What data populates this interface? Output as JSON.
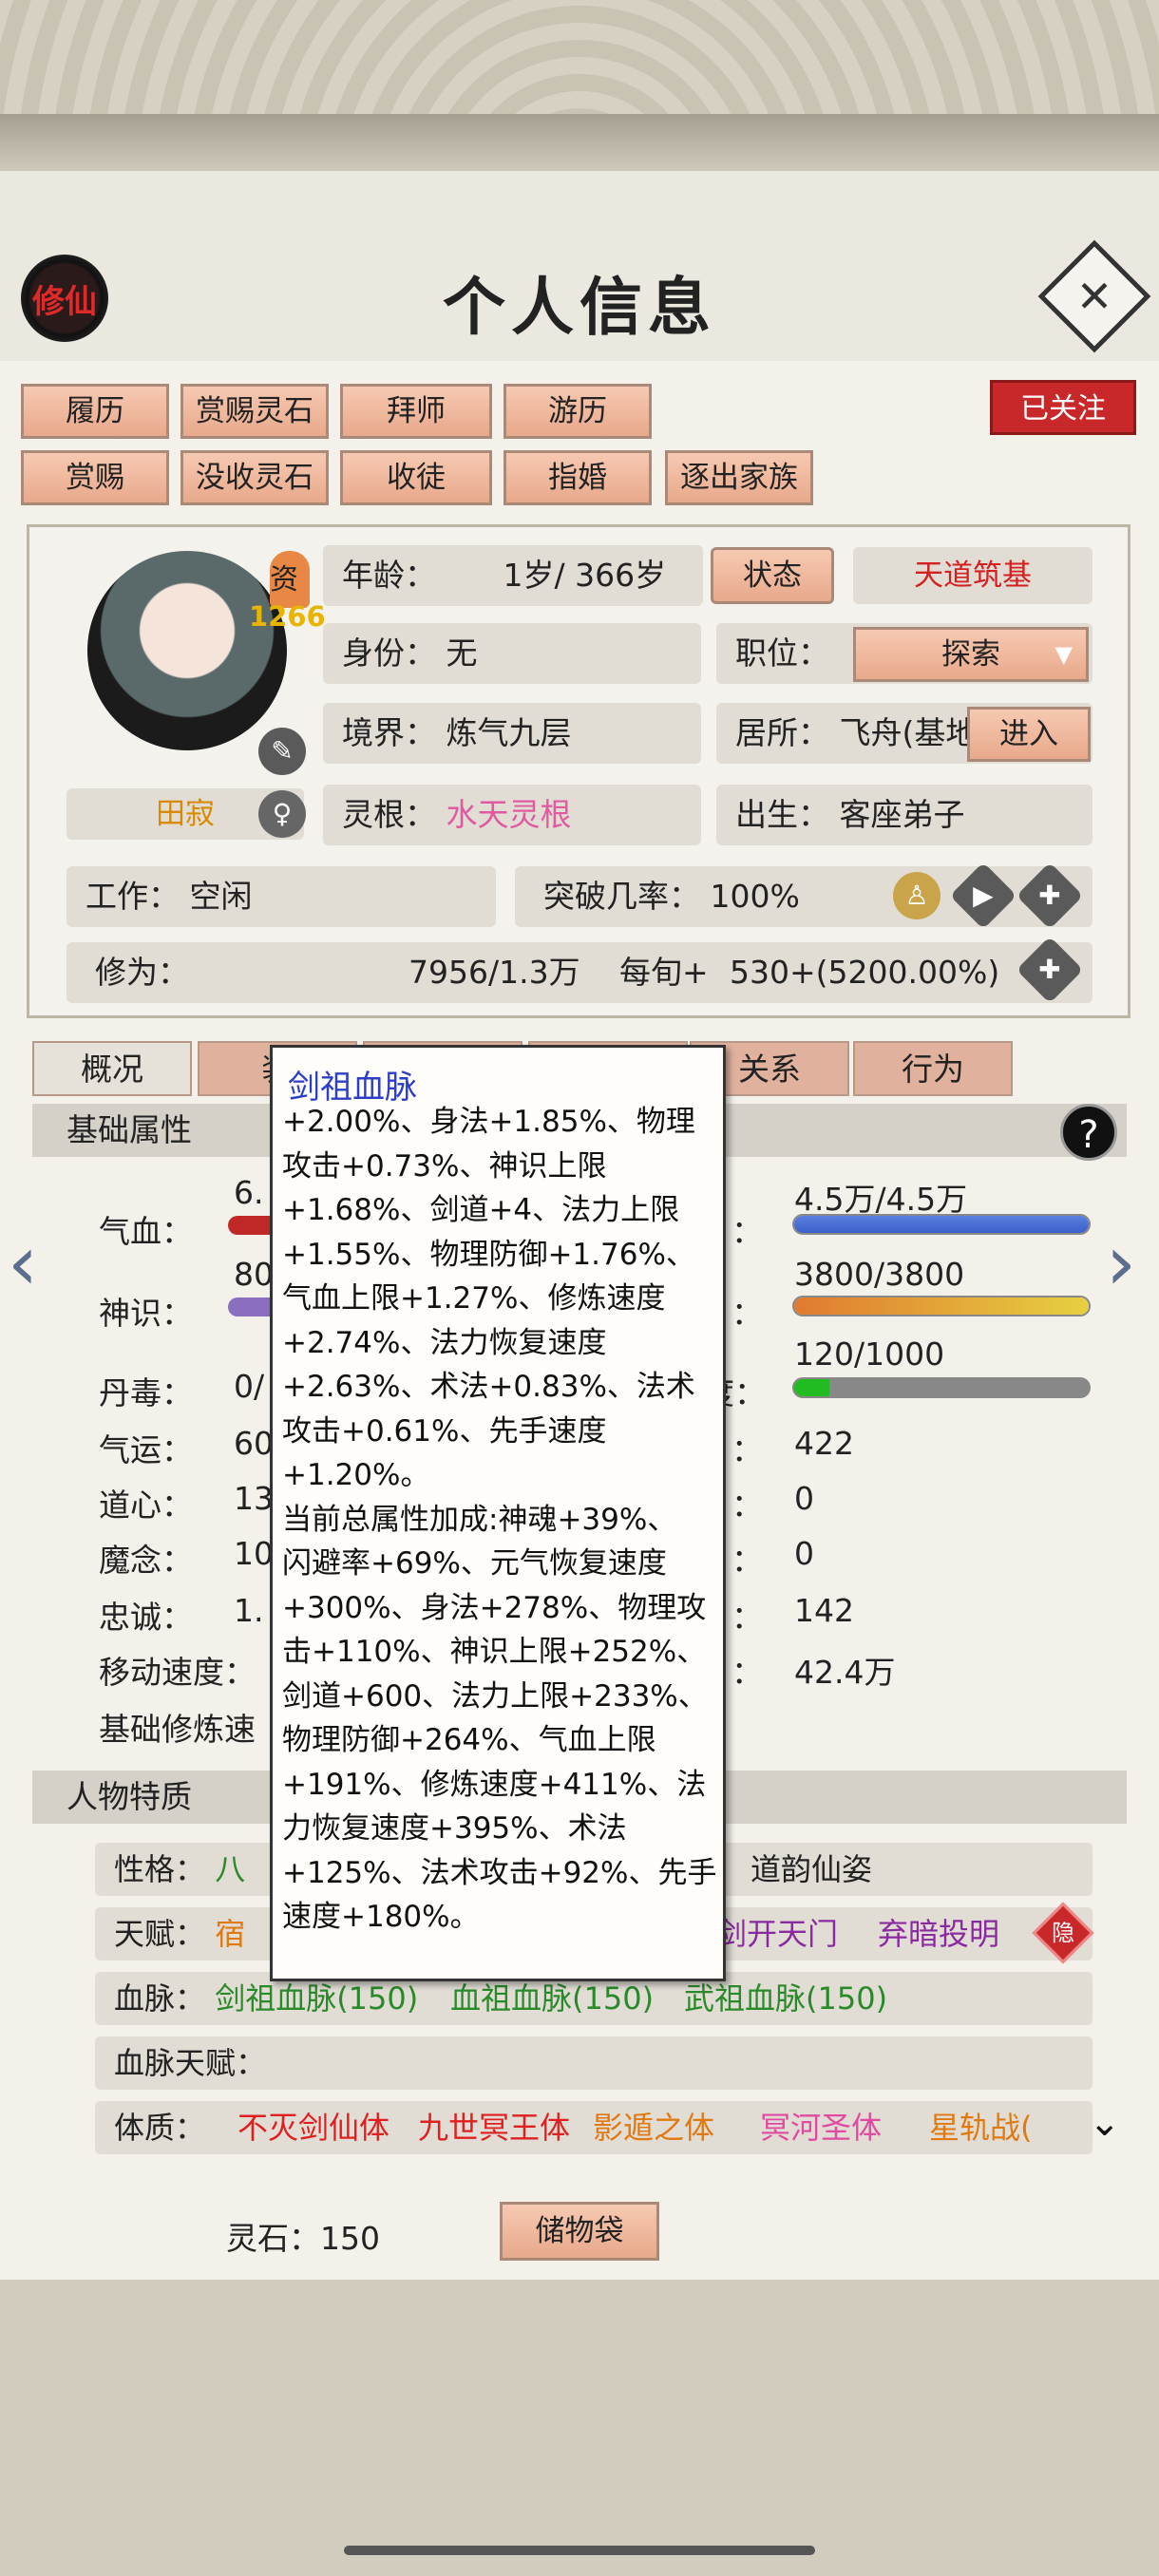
{
  "header": {
    "logo_text": "修仙",
    "title": "个人信息",
    "close_symbol": "✕"
  },
  "action_buttons": {
    "row1": [
      "履历",
      "赏赐灵石",
      "拜师",
      "游历"
    ],
    "row2": [
      "赏赐",
      "没收灵石",
      "收徒",
      "指婚",
      "逐出家族"
    ],
    "follow": "已关注"
  },
  "profile": {
    "badge_label": "资",
    "badge_value": "1266",
    "name": "田寂",
    "gender_icon": "female-icon",
    "age_label": "年龄：",
    "age_value": "1岁/ 366岁",
    "status_button": "状态",
    "status_value": "天道筑基",
    "identity_label": "身份：",
    "identity_value": "无",
    "position_label": "职位：",
    "position_value": "探索",
    "realm_label": "境界：",
    "realm_value": "炼气九层",
    "residence_label": "居所：",
    "residence_value": "飞舟(基地",
    "enter_button": "进入",
    "root_label": "灵根：",
    "root_value": "水天灵根",
    "birth_label": "出生：",
    "birth_value": "客座弟子",
    "work_label": "工作：",
    "work_value": "空闲",
    "breakthrough_label": "突破几率：",
    "breakthrough_value": "100%",
    "cultivation_label": "修为：",
    "cultivation_value": "7956/1.3万",
    "per_turn_label": "每旬+",
    "per_turn_value": "530+(5200.00%)"
  },
  "tabs": [
    "概况",
    "装",
    "",
    "",
    "关系",
    "行为"
  ],
  "basic_attrs": {
    "header": "基础属性",
    "help_icon": "?",
    "left": [
      {
        "label": "气血：",
        "value": "6."
      },
      {
        "label": "神识：",
        "value": "80"
      },
      {
        "label": "丹毒：",
        "value": "0/"
      },
      {
        "label": "气运：",
        "value": "60"
      },
      {
        "label": "道心：",
        "value": "13"
      },
      {
        "label": "魔念：",
        "value": "10"
      },
      {
        "label": "忠诚：",
        "value": "1."
      },
      {
        "label": "移动速度：",
        "value": ""
      },
      {
        "label": "基础修炼速",
        "value": ""
      }
    ],
    "right": [
      {
        "suffix": "：",
        "value": "4.5万/4.5万",
        "fill": 1.0,
        "color": "#3b5fc8"
      },
      {
        "suffix": "：",
        "value": "3800/3800",
        "fill": 1.0,
        "color": "#e0a030"
      },
      {
        "suffix": "度：",
        "value": "120/1000",
        "fill": 0.12,
        "color": "#22bb22"
      },
      {
        "suffix": "：",
        "value": "422"
      },
      {
        "suffix": "：",
        "value": "0"
      },
      {
        "suffix": "：",
        "value": "0"
      },
      {
        "suffix": "：",
        "value": "142"
      },
      {
        "suffix": "：",
        "value": "42.4万"
      }
    ]
  },
  "traits": {
    "header": "人物特质",
    "personality_label": "性格：",
    "personality_value": "八",
    "personality_extra": "道韵仙姿",
    "talent_label": "天赋：",
    "talent_value": "宿",
    "talent_a": "剑开天门",
    "talent_b": "弃暗投明",
    "hide_badge": "隐",
    "bloodline_label": "血脉：",
    "bloodlines": [
      "剑祖血脉(150)",
      "血祖血脉(150)",
      "武祖血脉(150)"
    ],
    "bloodline_talent_label": "血脉天赋：",
    "physique_label": "体质：",
    "physiques": [
      "不灭剑仙体",
      "九世冥王体",
      "影遁之体",
      "冥河圣体",
      "星轨战("
    ]
  },
  "footer": {
    "spirit_stone_label": "灵石：",
    "spirit_stone_value": "150",
    "storage_button": "储物袋"
  },
  "tooltip": {
    "title": "剑祖血脉",
    "body": "+2.00%、身法+1.85%、物理\n攻击+0.73%、神识上限\n+1.68%、剑道+4、法力上限\n+1.55%、物理防御+1.76%、\n气血上限+1.27%、修炼速度\n+2.74%、法力恢复速度\n+2.63%、术法+0.83%、法术\n攻击+0.61%、先手速度\n+1.20%。\n当前总属性加成:神魂+39%、\n闪避率+69%、元气恢复速度\n+300%、身法+278%、物理攻\n击+110%、神识上限+252%、\n剑道+600、法力上限+233%、\n物理防御+264%、气血上限\n+191%、修炼速度+411%、法\n力恢复速度+395%、术法\n+125%、法术攻击+92%、先手\n速度+180%。"
  },
  "colors": {
    "accent_red": "#c8282a",
    "button_peach": "#eab39b",
    "tooltip_title": "#2b3ec6",
    "bloodline_green": "#2a8a2a",
    "physique_red": "#e02020",
    "physique_orange": "#e07a10",
    "physique_pink": "#e04aa0"
  }
}
